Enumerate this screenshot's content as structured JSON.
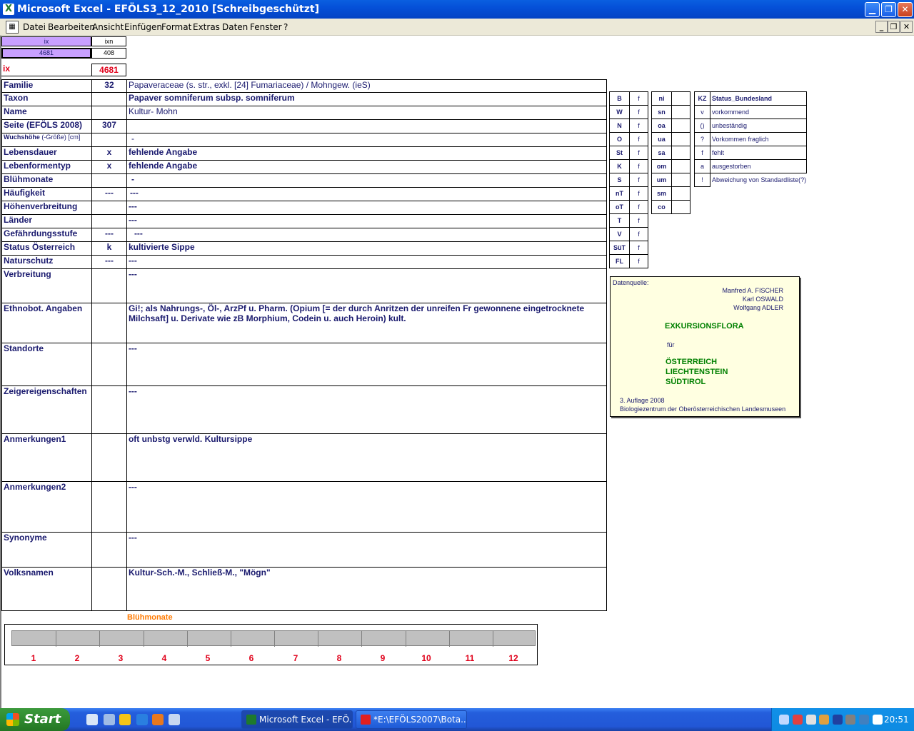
{
  "window": {
    "app_icon": "X",
    "title": "Microsoft Excel - EFÖLS3_12_2010  [Schreibgeschützt]",
    "minimize": "▁",
    "restore": "❐",
    "close": "✕"
  },
  "menu": {
    "items": [
      "Datei",
      "Bearbeiten",
      "Ansicht",
      "Einfügen",
      "Format",
      "Extras",
      "Daten",
      "Fenster",
      "?"
    ],
    "doc_min": "_",
    "doc_restore": "❐",
    "doc_close": "✕"
  },
  "header": {
    "ix_label": "ix",
    "ixn_label": "ixn",
    "ix_value": "4681",
    "ixn_value": "408",
    "big_ix_label": "ix",
    "big_ix_value": "4681"
  },
  "rows": [
    {
      "label": "Familie",
      "mid": "32",
      "value": "Papaveraceae (s. str., exkl. [24] Fumariaceae)  /  Mohngew. (ieS)"
    },
    {
      "label": "Taxon",
      "mid": "",
      "value": "Papaver somniferum subsp. somniferum"
    },
    {
      "label": "Name",
      "mid": "",
      "value": "Kultur- Mohn"
    },
    {
      "label": "Seite (EFÖLS 2008)",
      "mid": "307",
      "value": ""
    },
    {
      "label": "Wuchshöhe",
      "label_suffix": "(-Größe) [cm]",
      "mid": "",
      "value": "-"
    },
    {
      "label": "Lebensdauer",
      "mid": "x",
      "value": "fehlende Angabe"
    },
    {
      "label": "Lebenformentyp",
      "mid": "x",
      "value": "fehlende Angabe"
    },
    {
      "label": "Blühmonate",
      "mid": "",
      "value": "-"
    },
    {
      "label": "Häufigkeit",
      "mid": "---",
      "value": "---"
    },
    {
      "label": "Höhenverbreitung",
      "mid": "",
      "value": "---"
    },
    {
      "label": "Länder",
      "mid": "",
      "value": "---"
    },
    {
      "label": "Gefährdungsstufe",
      "mid": "---",
      "value": "---"
    },
    {
      "label": "Status Österreich",
      "mid": "k",
      "value": "kultivierte Sippe"
    },
    {
      "label": "Naturschutz",
      "mid": "---",
      "value": "---"
    },
    {
      "label": "Verbreitung",
      "mid": "",
      "value": "---"
    },
    {
      "label": "Ethnobot. Angaben",
      "mid": "",
      "value": "Gi!; als Nahrungs-, Öl-, ArzPf u. Pharm. (Opium [= der durch Anritzen der unreifen Fr gewonnene eingetrocknete Milchsaft] u. Derivate wie zB Morphium, Codein u. auch Heroin) kult."
    },
    {
      "label": "Standorte",
      "mid": "",
      "value": "---"
    },
    {
      "label": "Zeigereigenschaften",
      "mid": "",
      "value": "---"
    },
    {
      "label": "Anmerkungen1",
      "mid": "",
      "value": "oft unbstg verwld. Kultursippe"
    },
    {
      "label": "Anmerkungen2",
      "mid": "",
      "value": "---"
    },
    {
      "label": "Synonyme",
      "mid": "",
      "value": "---"
    },
    {
      "label": "Volksnamen",
      "mid": "",
      "value": "Kultur-Sch.-M., Schließ-M., \"Mögn\""
    }
  ],
  "regions": [
    {
      "code": "B",
      "f": "f"
    },
    {
      "code": "W",
      "f": "f"
    },
    {
      "code": "N",
      "f": "f"
    },
    {
      "code": "O",
      "f": "f"
    },
    {
      "code": "St",
      "f": "f"
    },
    {
      "code": "K",
      "f": "f"
    },
    {
      "code": "S",
      "f": "f"
    },
    {
      "code": "nT",
      "f": "f"
    },
    {
      "code": "oT",
      "f": "f"
    },
    {
      "code": "T",
      "f": "f"
    },
    {
      "code": "V",
      "f": "f"
    },
    {
      "code": "SüT",
      "f": "f"
    },
    {
      "code": "FL",
      "f": "f"
    }
  ],
  "altitudes": [
    {
      "code": "ni"
    },
    {
      "code": "sn"
    },
    {
      "code": "oa"
    },
    {
      "code": "ua"
    },
    {
      "code": "sa"
    },
    {
      "code": "om"
    },
    {
      "code": "um"
    },
    {
      "code": "sm"
    },
    {
      "code": "co"
    }
  ],
  "status_legend": {
    "header_kz": "KZ",
    "header_text": "Status_Bundesland",
    "items": [
      {
        "kz": "v",
        "text": "vorkommend"
      },
      {
        "kz": "()",
        "text": "unbeständig"
      },
      {
        "kz": "?",
        "text": "Vorkommen fraglich"
      },
      {
        "kz": "f",
        "text": "fehlt"
      },
      {
        "kz": "a",
        "text": "ausgestorben"
      },
      {
        "kz": "!",
        "text": "Abweichung von Standardliste(?)"
      }
    ]
  },
  "source": {
    "label": "Datenquelle:",
    "authors": [
      "Manfred A. FISCHER",
      "Karl OSWALD",
      "Wolfgang ADLER"
    ],
    "book_title": "EXKURSIONSFLORA",
    "fuer": "für",
    "countries": [
      "ÖSTERREICH",
      "LIECHTENSTEIN",
      "SÜDTIROL"
    ],
    "edition": "3. Auflage 2008",
    "publisher": "Biologiezentrum der Oberösterreichischen Landesmuseen"
  },
  "bloom": {
    "title": "Blühmonate",
    "months": [
      "1",
      "2",
      "3",
      "4",
      "5",
      "6",
      "7",
      "8",
      "9",
      "10",
      "11",
      "12"
    ]
  },
  "taskbar": {
    "start_label": "Start",
    "tasks": [
      {
        "label": "Microsoft Excel - EFÖ..."
      },
      {
        "label": "*E:\\EFÖLS2007\\Bota..."
      }
    ],
    "clock": "20:51"
  }
}
